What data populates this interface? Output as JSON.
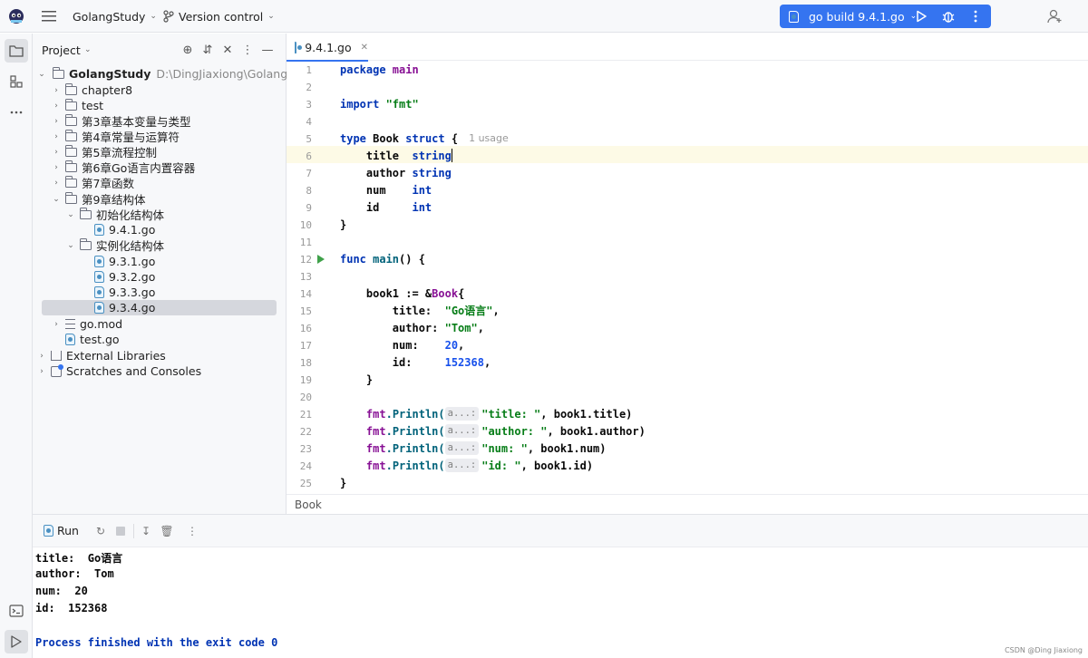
{
  "titlebar": {
    "project_name": "GolangStudy",
    "vcs_label": "Version control",
    "run_config": "go build 9.4.1.go"
  },
  "project_panel": {
    "title": "Project",
    "root": {
      "name": "GolangStudy",
      "path": "D:\\DingJiaxiong\\GolangStudy"
    },
    "items": [
      {
        "label": "chapter8"
      },
      {
        "label": "test"
      },
      {
        "label": "第3章基本变量与类型"
      },
      {
        "label": "第4章常量与运算符"
      },
      {
        "label": "第5章流程控制"
      },
      {
        "label": "第6章Go语言内置容器"
      },
      {
        "label": "第7章函数"
      },
      {
        "label": "第9章结构体"
      },
      {
        "label": "初始化结构体"
      },
      {
        "label": "9.4.1.go"
      },
      {
        "label": "实例化结构体"
      },
      {
        "label": "9.3.1.go"
      },
      {
        "label": "9.3.2.go"
      },
      {
        "label": "9.3.3.go"
      },
      {
        "label": "9.3.4.go"
      },
      {
        "label": "go.mod"
      },
      {
        "label": "test.go"
      },
      {
        "label": "External Libraries"
      },
      {
        "label": "Scratches and Consoles"
      }
    ]
  },
  "editor": {
    "active_tab": "9.4.1.go",
    "line_numbers": [
      "1",
      "2",
      "3",
      "4",
      "5",
      "6",
      "7",
      "8",
      "9",
      "10",
      "11",
      "12",
      "13",
      "14",
      "15",
      "16",
      "17",
      "18",
      "19",
      "20",
      "21",
      "22",
      "23",
      "24",
      "25"
    ],
    "code": {
      "l1_kw": "package",
      "l1_name": " main",
      "l3_kw": "import",
      "l3_str": " \"fmt\"",
      "l5_kw1": "type",
      "l5_name": " Book ",
      "l5_kw2": "struct",
      "l5_brace": " {",
      "l5_usage": "1 usage",
      "l6_field": "    title  ",
      "l6_type": "string",
      "l7_field": "    author ",
      "l7_type": "string",
      "l8_field": "    num    ",
      "l8_type": "int",
      "l9_field": "    id     ",
      "l9_type": "int",
      "l10": "}",
      "l12_kw": "func",
      "l12_fn": " main",
      "l12_rest": "() {",
      "l14_a": "    book1 := &",
      "l14_type": "Book",
      "l14_b": "{",
      "l15_key": "        title:  ",
      "l15_val": "\"Go语言\"",
      "l15_end": ",",
      "l16_key": "        author: ",
      "l16_val": "\"Tom\"",
      "l16_end": ",",
      "l17_key": "        num:    ",
      "l17_val": "20",
      "l17_end": ",",
      "l18_key": "        id:     ",
      "l18_val": "152368",
      "l18_end": ",",
      "l19": "    }",
      "hint": "a...:",
      "l21_pkg": "fmt",
      "l21_fn": ".Println(",
      "l21_str": "\"title: \"",
      "l21_rest": ", book1.title)",
      "l22_pkg": "fmt",
      "l22_fn": ".Println(",
      "l22_str": "\"author: \"",
      "l22_rest": ", book1.author)",
      "l23_pkg": "fmt",
      "l23_fn": ".Println(",
      "l23_str": "\"num: \"",
      "l23_rest": ", book1.num)",
      "l24_pkg": "fmt",
      "l24_fn": ".Println(",
      "l24_str": "\"id: \"",
      "l24_rest": ", book1.id)",
      "l25": "}"
    },
    "breadcrumb": "Book"
  },
  "run_panel": {
    "tab_label": "Run",
    "output": [
      "title:  Go语言",
      "author:  Tom",
      "num:  20",
      "id:  152368",
      "",
      "Process finished with the exit code 0"
    ]
  },
  "watermark": "CSDN @Ding Jiaxiong",
  "colors": {
    "accent": "#3574f0",
    "keyword": "#0033b3",
    "string": "#067d17",
    "number": "#1750eb",
    "function": "#00627a",
    "run_green": "#3fa14a"
  }
}
